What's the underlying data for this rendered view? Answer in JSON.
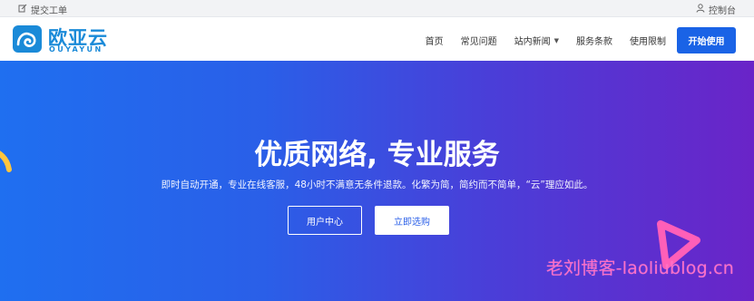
{
  "topbar": {
    "ticket_label": "提交工单",
    "console_label": "控制台"
  },
  "brand": {
    "name": "欧亚云",
    "subname": "OUYAYUN",
    "color": "#1a8ad8"
  },
  "nav": {
    "items": [
      {
        "label": "首页"
      },
      {
        "label": "常见问题"
      },
      {
        "label": "站内新闻",
        "has_dropdown": true
      },
      {
        "label": "服务条款"
      },
      {
        "label": "使用限制"
      }
    ],
    "cta_label": "开始使用",
    "cta_color": "#1a63e6"
  },
  "hero": {
    "title": "优质网络, 专业服务",
    "subtitle": "即时自动开通，专业在线客服，48小时不满意无条件退款。化繁为简，简约而不简单，“云”理应如此。",
    "primary_button": "用户中心",
    "secondary_button": "立即选购",
    "gradient": [
      "#1f6ff0",
      "#6a24c8"
    ]
  },
  "watermark": {
    "text": "老刘博客-laoliublog.cn",
    "color": "#ff6ec7"
  }
}
